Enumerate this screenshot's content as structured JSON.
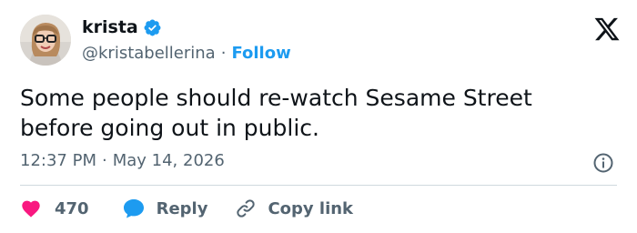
{
  "author": {
    "display_name": "krista",
    "handle": "@kristabellerina",
    "separator": "·",
    "follow_label": "Follow",
    "verified_icon": "verified-badge-icon"
  },
  "brand": {
    "logo_icon": "x-logo-icon"
  },
  "tweet": {
    "text": "Some people should re-watch Sesame Street\nbefore going out in public.",
    "time": "12:37 PM",
    "date_separator": "·",
    "date": "May 14, 2026",
    "info_icon": "info-icon"
  },
  "actions": {
    "like_icon": "heart-icon",
    "like_count": "470",
    "reply_icon": "reply-bubble-icon",
    "reply_label": "Reply",
    "copy_icon": "link-icon",
    "copy_label": "Copy link"
  },
  "colors": {
    "accent": "#1d9bf0",
    "like": "#f91880",
    "text_primary": "#0f1419",
    "text_secondary": "#536471",
    "divider": "#cfd9de"
  }
}
